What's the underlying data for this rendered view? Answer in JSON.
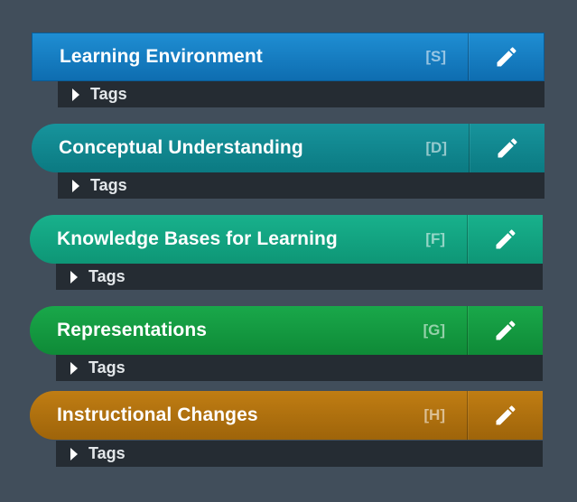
{
  "tags_label": "Tags",
  "items": [
    {
      "title": "Learning Environment",
      "shortcut": "[S]",
      "color_top": "#1f8ed3",
      "color_bottom": "#0e6db0",
      "shape": "square"
    },
    {
      "title": "Conceptual Understanding",
      "shortcut": "[D]",
      "color_top": "#17949c",
      "color_bottom": "#0b7a82",
      "shape": "rounded"
    },
    {
      "title": "Knowledge Bases for Learning",
      "shortcut": "[F]",
      "color_top": "#18b18c",
      "color_bottom": "#0e9676",
      "shape": "rounded"
    },
    {
      "title": "Representations",
      "shortcut": "[G]",
      "color_top": "#19a84a",
      "color_bottom": "#0f8a37",
      "shape": "rounded"
    },
    {
      "title": "Instructional Changes",
      "shortcut": "[H]",
      "color_top": "#c07d13",
      "color_bottom": "#9e640a",
      "shape": "rounded"
    }
  ]
}
